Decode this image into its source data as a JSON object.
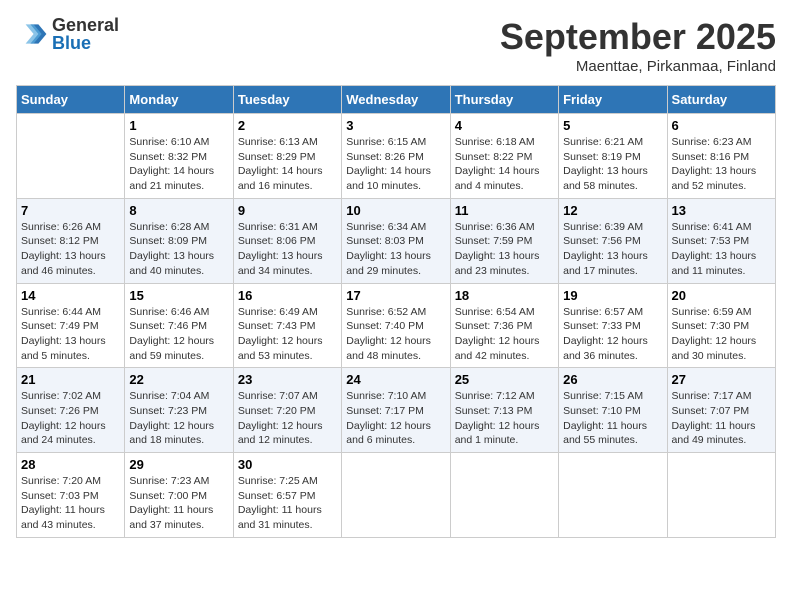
{
  "header": {
    "logo_general": "General",
    "logo_blue": "Blue",
    "month_title": "September 2025",
    "location": "Maenttae, Pirkanmaa, Finland"
  },
  "weekdays": [
    "Sunday",
    "Monday",
    "Tuesday",
    "Wednesday",
    "Thursday",
    "Friday",
    "Saturday"
  ],
  "weeks": [
    [
      {
        "day": "",
        "sunrise": "",
        "sunset": "",
        "daylight": ""
      },
      {
        "day": "1",
        "sunrise": "Sunrise: 6:10 AM",
        "sunset": "Sunset: 8:32 PM",
        "daylight": "Daylight: 14 hours and 21 minutes."
      },
      {
        "day": "2",
        "sunrise": "Sunrise: 6:13 AM",
        "sunset": "Sunset: 8:29 PM",
        "daylight": "Daylight: 14 hours and 16 minutes."
      },
      {
        "day": "3",
        "sunrise": "Sunrise: 6:15 AM",
        "sunset": "Sunset: 8:26 PM",
        "daylight": "Daylight: 14 hours and 10 minutes."
      },
      {
        "day": "4",
        "sunrise": "Sunrise: 6:18 AM",
        "sunset": "Sunset: 8:22 PM",
        "daylight": "Daylight: 14 hours and 4 minutes."
      },
      {
        "day": "5",
        "sunrise": "Sunrise: 6:21 AM",
        "sunset": "Sunset: 8:19 PM",
        "daylight": "Daylight: 13 hours and 58 minutes."
      },
      {
        "day": "6",
        "sunrise": "Sunrise: 6:23 AM",
        "sunset": "Sunset: 8:16 PM",
        "daylight": "Daylight: 13 hours and 52 minutes."
      }
    ],
    [
      {
        "day": "7",
        "sunrise": "Sunrise: 6:26 AM",
        "sunset": "Sunset: 8:12 PM",
        "daylight": "Daylight: 13 hours and 46 minutes."
      },
      {
        "day": "8",
        "sunrise": "Sunrise: 6:28 AM",
        "sunset": "Sunset: 8:09 PM",
        "daylight": "Daylight: 13 hours and 40 minutes."
      },
      {
        "day": "9",
        "sunrise": "Sunrise: 6:31 AM",
        "sunset": "Sunset: 8:06 PM",
        "daylight": "Daylight: 13 hours and 34 minutes."
      },
      {
        "day": "10",
        "sunrise": "Sunrise: 6:34 AM",
        "sunset": "Sunset: 8:03 PM",
        "daylight": "Daylight: 13 hours and 29 minutes."
      },
      {
        "day": "11",
        "sunrise": "Sunrise: 6:36 AM",
        "sunset": "Sunset: 7:59 PM",
        "daylight": "Daylight: 13 hours and 23 minutes."
      },
      {
        "day": "12",
        "sunrise": "Sunrise: 6:39 AM",
        "sunset": "Sunset: 7:56 PM",
        "daylight": "Daylight: 13 hours and 17 minutes."
      },
      {
        "day": "13",
        "sunrise": "Sunrise: 6:41 AM",
        "sunset": "Sunset: 7:53 PM",
        "daylight": "Daylight: 13 hours and 11 minutes."
      }
    ],
    [
      {
        "day": "14",
        "sunrise": "Sunrise: 6:44 AM",
        "sunset": "Sunset: 7:49 PM",
        "daylight": "Daylight: 13 hours and 5 minutes."
      },
      {
        "day": "15",
        "sunrise": "Sunrise: 6:46 AM",
        "sunset": "Sunset: 7:46 PM",
        "daylight": "Daylight: 12 hours and 59 minutes."
      },
      {
        "day": "16",
        "sunrise": "Sunrise: 6:49 AM",
        "sunset": "Sunset: 7:43 PM",
        "daylight": "Daylight: 12 hours and 53 minutes."
      },
      {
        "day": "17",
        "sunrise": "Sunrise: 6:52 AM",
        "sunset": "Sunset: 7:40 PM",
        "daylight": "Daylight: 12 hours and 48 minutes."
      },
      {
        "day": "18",
        "sunrise": "Sunrise: 6:54 AM",
        "sunset": "Sunset: 7:36 PM",
        "daylight": "Daylight: 12 hours and 42 minutes."
      },
      {
        "day": "19",
        "sunrise": "Sunrise: 6:57 AM",
        "sunset": "Sunset: 7:33 PM",
        "daylight": "Daylight: 12 hours and 36 minutes."
      },
      {
        "day": "20",
        "sunrise": "Sunrise: 6:59 AM",
        "sunset": "Sunset: 7:30 PM",
        "daylight": "Daylight: 12 hours and 30 minutes."
      }
    ],
    [
      {
        "day": "21",
        "sunrise": "Sunrise: 7:02 AM",
        "sunset": "Sunset: 7:26 PM",
        "daylight": "Daylight: 12 hours and 24 minutes."
      },
      {
        "day": "22",
        "sunrise": "Sunrise: 7:04 AM",
        "sunset": "Sunset: 7:23 PM",
        "daylight": "Daylight: 12 hours and 18 minutes."
      },
      {
        "day": "23",
        "sunrise": "Sunrise: 7:07 AM",
        "sunset": "Sunset: 7:20 PM",
        "daylight": "Daylight: 12 hours and 12 minutes."
      },
      {
        "day": "24",
        "sunrise": "Sunrise: 7:10 AM",
        "sunset": "Sunset: 7:17 PM",
        "daylight": "Daylight: 12 hours and 6 minutes."
      },
      {
        "day": "25",
        "sunrise": "Sunrise: 7:12 AM",
        "sunset": "Sunset: 7:13 PM",
        "daylight": "Daylight: 12 hours and 1 minute."
      },
      {
        "day": "26",
        "sunrise": "Sunrise: 7:15 AM",
        "sunset": "Sunset: 7:10 PM",
        "daylight": "Daylight: 11 hours and 55 minutes."
      },
      {
        "day": "27",
        "sunrise": "Sunrise: 7:17 AM",
        "sunset": "Sunset: 7:07 PM",
        "daylight": "Daylight: 11 hours and 49 minutes."
      }
    ],
    [
      {
        "day": "28",
        "sunrise": "Sunrise: 7:20 AM",
        "sunset": "Sunset: 7:03 PM",
        "daylight": "Daylight: 11 hours and 43 minutes."
      },
      {
        "day": "29",
        "sunrise": "Sunrise: 7:23 AM",
        "sunset": "Sunset: 7:00 PM",
        "daylight": "Daylight: 11 hours and 37 minutes."
      },
      {
        "day": "30",
        "sunrise": "Sunrise: 7:25 AM",
        "sunset": "Sunset: 6:57 PM",
        "daylight": "Daylight: 11 hours and 31 minutes."
      },
      {
        "day": "",
        "sunrise": "",
        "sunset": "",
        "daylight": ""
      },
      {
        "day": "",
        "sunrise": "",
        "sunset": "",
        "daylight": ""
      },
      {
        "day": "",
        "sunrise": "",
        "sunset": "",
        "daylight": ""
      },
      {
        "day": "",
        "sunrise": "",
        "sunset": "",
        "daylight": ""
      }
    ]
  ]
}
